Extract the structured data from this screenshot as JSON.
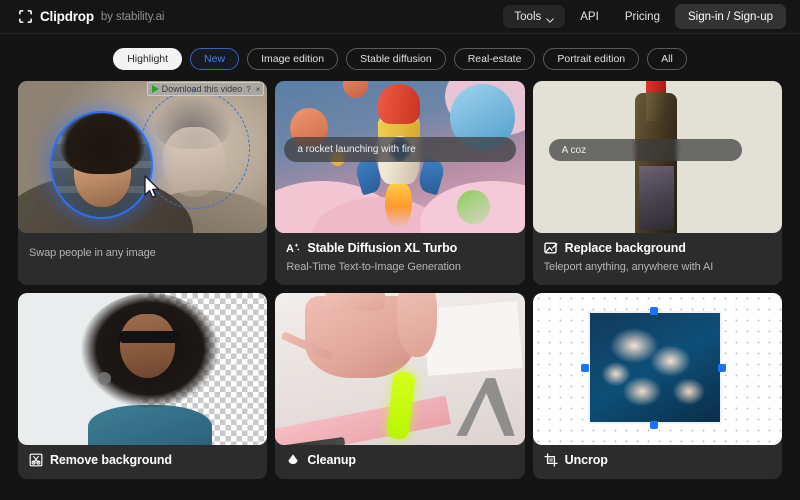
{
  "header": {
    "brand_name": "Clipdrop",
    "brand_by": "by stability.ai",
    "logo_icon": "clipdrop-brackets-icon",
    "nav": {
      "tools_label": "Tools",
      "tools_icon": "chevron-down-icon",
      "api_label": "API",
      "pricing_label": "Pricing",
      "signin_label": "Sign-in / Sign-up"
    }
  },
  "filters": [
    {
      "label": "Highlight",
      "state": "active"
    },
    {
      "label": "New",
      "state": "accent"
    },
    {
      "label": "Image edition",
      "state": "default"
    },
    {
      "label": "Stable diffusion",
      "state": "default"
    },
    {
      "label": "Real-estate",
      "state": "default"
    },
    {
      "label": "Portrait edition",
      "state": "default"
    },
    {
      "label": "All",
      "state": "default"
    }
  ],
  "downloader_overlay": {
    "label": "Download this video",
    "play_icon": "play-triangle-icon",
    "help_label": "?",
    "close_label": "×"
  },
  "cards": [
    {
      "title": "",
      "subtitle": "Swap people in any image",
      "icon": "",
      "media": "face-swap-preview"
    },
    {
      "title": "Stable Diffusion XL Turbo",
      "subtitle": "Real-Time Text-to-Image Generation",
      "icon": "magic-text-icon",
      "media": "rocket-generation-preview",
      "prompt": "a rocket launching with fire"
    },
    {
      "title": "Replace background",
      "subtitle": "Teleport anything, anywhere with AI",
      "icon": "image-edit-icon",
      "media": "wine-bottle-preview",
      "prompt": "A coz"
    },
    {
      "title": "Remove background",
      "subtitle": "",
      "icon": "scissors-icon",
      "media": "cutout-checkerboard-preview"
    },
    {
      "title": "Cleanup",
      "subtitle": "",
      "icon": "eraser-drop-icon",
      "media": "object-removal-preview"
    },
    {
      "title": "Uncrop",
      "subtitle": "",
      "icon": "crop-expand-icon",
      "media": "uncrop-canvas-preview"
    }
  ],
  "colors": {
    "page_bg": "#141414",
    "card_bg": "#2c2c2c",
    "accent_blue": "#4d7fe8",
    "chip_active_bg": "#f3f3f3",
    "handle_blue": "#1a73ff"
  }
}
